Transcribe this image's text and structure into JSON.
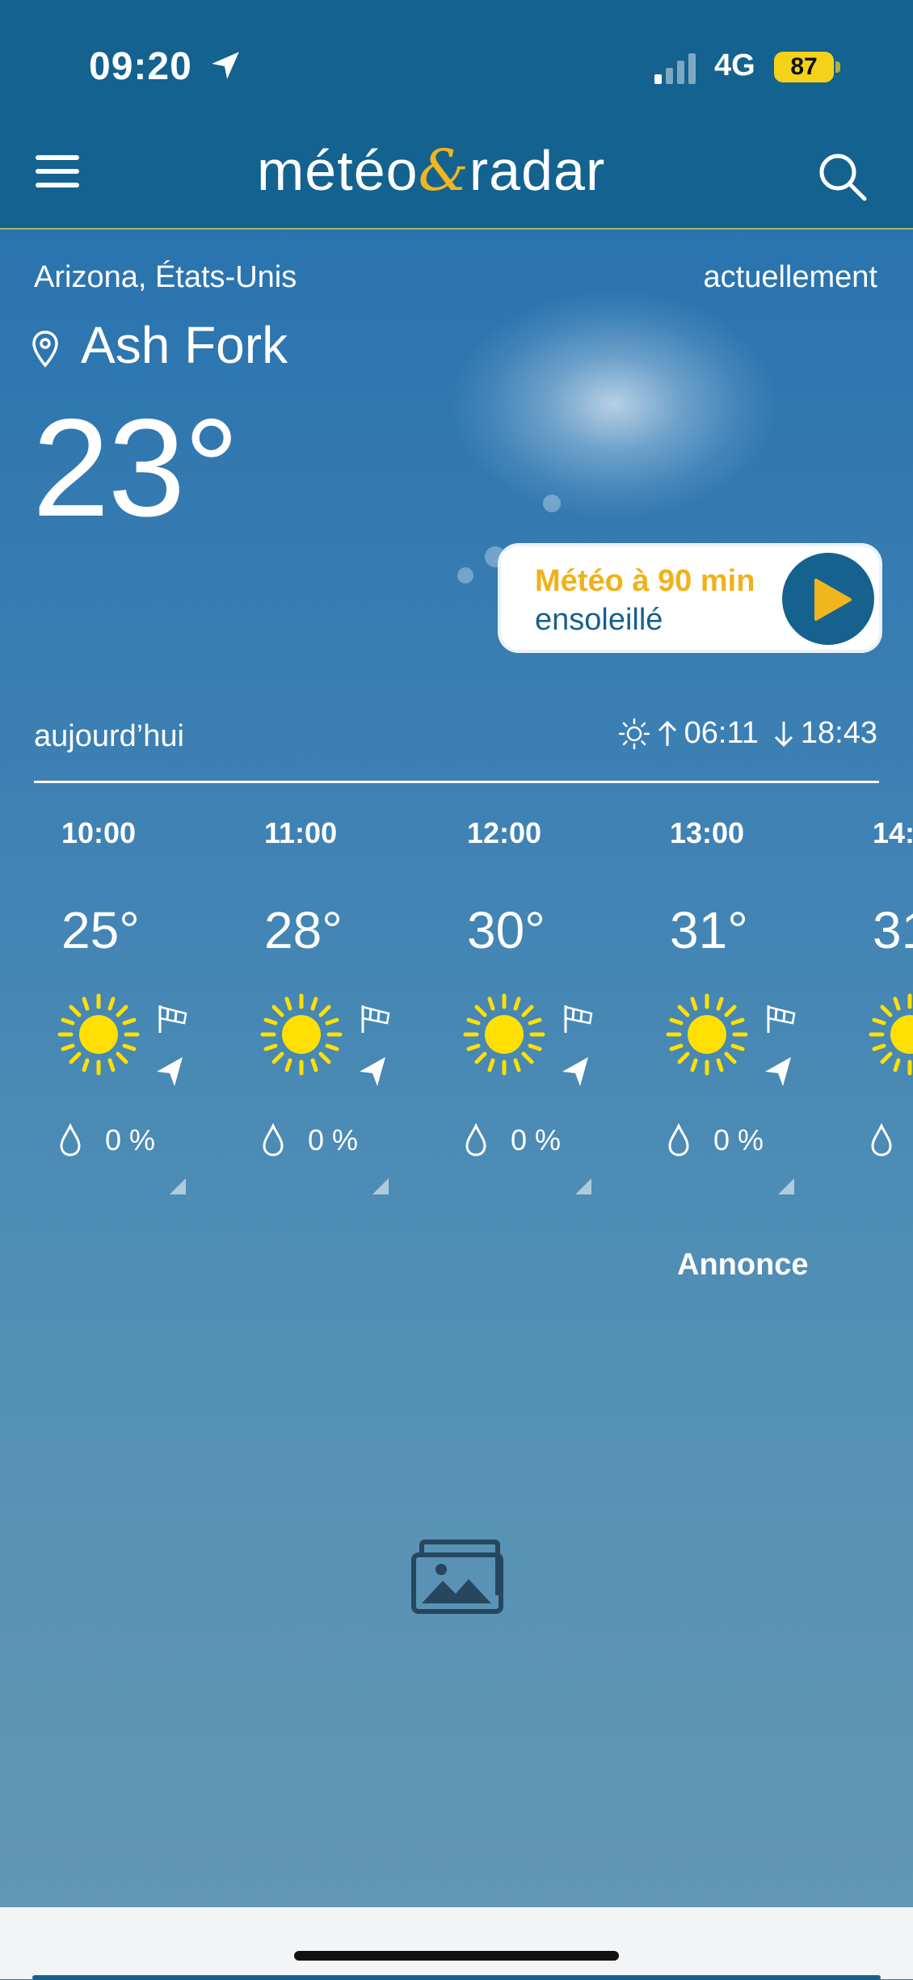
{
  "status_bar": {
    "time": "09:20",
    "network": "4G",
    "battery": "87"
  },
  "header": {
    "logo_left": "météo",
    "logo_amp": "&",
    "logo_right": "radar"
  },
  "location": {
    "region": "Arizona, États-Unis",
    "city": "Ash Fork",
    "current_label": "actuellement",
    "temperature": "23°"
  },
  "nowcast": {
    "title": "Météo à 90 min",
    "condition": "ensoleillé"
  },
  "today": {
    "label": "aujourd’hui",
    "sunrise": "06:11",
    "sunset": "18:43"
  },
  "hourly": [
    {
      "time": "10:00",
      "temp": "25°",
      "precip": "0 %",
      "icon": "sun-icon"
    },
    {
      "time": "11:00",
      "temp": "28°",
      "precip": "0 %",
      "icon": "sun-icon"
    },
    {
      "time": "12:00",
      "temp": "30°",
      "precip": "0 %",
      "icon": "sun-icon"
    },
    {
      "time": "13:00",
      "temp": "31°",
      "precip": "0 %",
      "icon": "sun-icon"
    },
    {
      "time": "14:",
      "temp": "31",
      "precip": "",
      "icon": "sun-icon"
    }
  ],
  "ad": {
    "label": "Annonce"
  },
  "colors": {
    "header": "#13628f",
    "accent": "#f1b51e",
    "sun": "#ffe000"
  }
}
